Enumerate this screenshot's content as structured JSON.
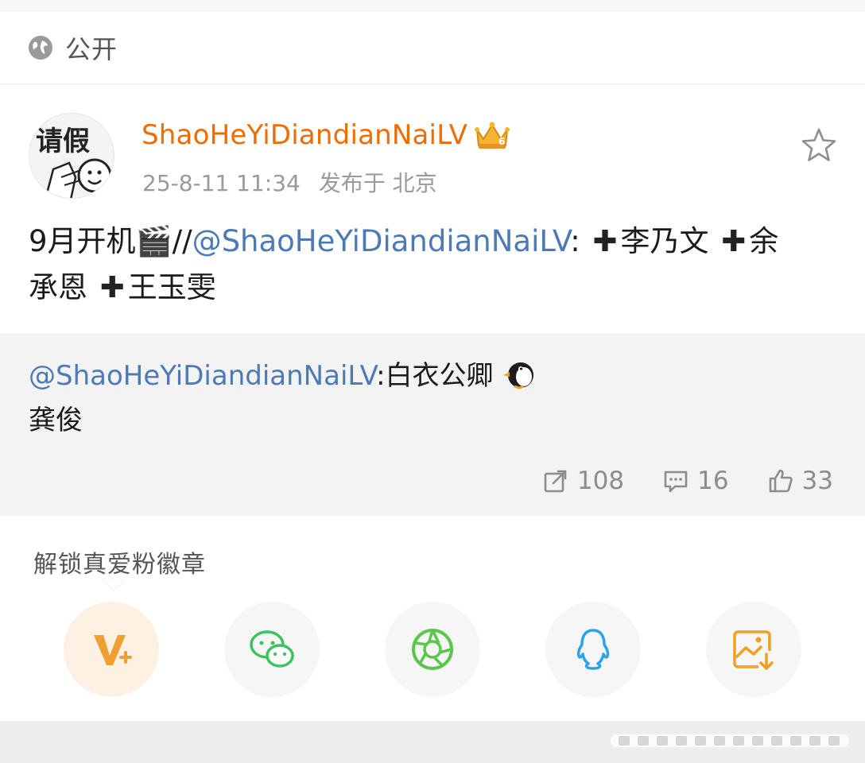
{
  "visibility": {
    "label": "公开",
    "icon": "globe-icon"
  },
  "post": {
    "username": "ShaoHeYiDiandianNaiLV",
    "crown_icon": "crown-vip-icon",
    "timestamp": "25-8-11 11:34",
    "location": "发布于 北京",
    "favorite_icon": "star-outline-icon",
    "text_prefix": "9月开机",
    "emoji_clapper": "🎬",
    "slashes": "//",
    "mention": "@ShaoHeYiDiandianNaiLV",
    "colon": ":",
    "plus": "✚",
    "name1": "李乃文",
    "name2_part1": "余",
    "name2_part2": "承恩",
    "name3": "王玉雯"
  },
  "repost": {
    "mention": "@ShaoHeYiDiandianNaiLV",
    "colon": ":",
    "text_line1": "白衣公卿",
    "penguin_icon": "penguin-icon",
    "text_line2": "龚俊"
  },
  "stats": {
    "reposts": "108",
    "comments": "16",
    "likes": "33"
  },
  "share": {
    "badge_label": "解锁真爱粉徽章",
    "buttons": [
      {
        "name": "vip-share",
        "icon": "v-plus-icon",
        "color": "#f0a030"
      },
      {
        "name": "wechat",
        "icon": "wechat-icon",
        "color": "#3ec15f"
      },
      {
        "name": "moments",
        "icon": "moments-aperture-icon",
        "color": "#5cc64a"
      },
      {
        "name": "qq",
        "icon": "qq-penguin-icon",
        "color": "#2aa3e8"
      },
      {
        "name": "save-image",
        "icon": "save-image-icon",
        "color": "#f0a020"
      }
    ]
  },
  "colors": {
    "username": "#f06b00",
    "mention": "#4b7ab6",
    "meta": "#9a9a9a",
    "repost_bg": "#f3f3f3"
  }
}
